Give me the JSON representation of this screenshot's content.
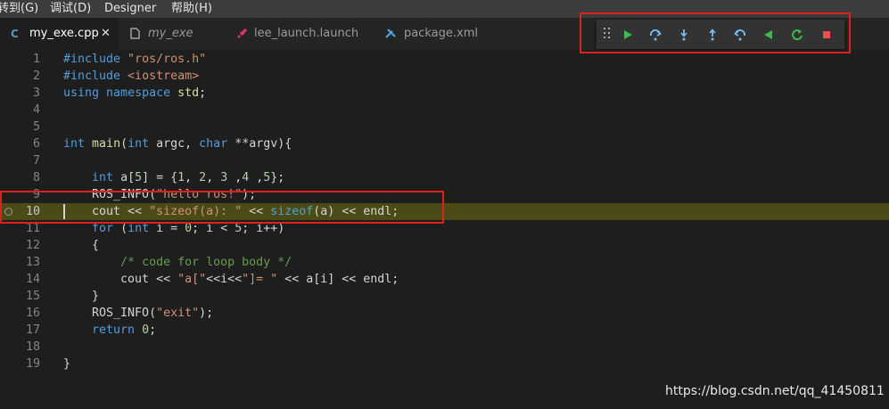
{
  "menubar": {
    "items": [
      "转到(G)",
      "调试(D)",
      "Designer",
      "帮助(H)"
    ]
  },
  "tabs": [
    {
      "label": "my_exe.cpp",
      "icon": "cpp-icon",
      "active": true
    },
    {
      "label": "my_exe",
      "icon": "file-icon",
      "active": false
    },
    {
      "label": "lee_launch.launch",
      "icon": "rocket-icon",
      "active": false
    },
    {
      "label": "package.xml",
      "icon": "tools-icon",
      "active": false
    }
  ],
  "debug_toolbar": {
    "buttons": [
      "continue",
      "step-over",
      "step-into",
      "step-out",
      "step-back",
      "reverse-continue",
      "restart",
      "stop"
    ]
  },
  "editor": {
    "current_line": 10,
    "line_numbers": [
      "1",
      "2",
      "3",
      "4",
      "5",
      "6",
      "7",
      "8",
      "9",
      "10",
      "11",
      "12",
      "13",
      "14",
      "15",
      "16",
      "17",
      "18",
      "19"
    ],
    "lines": [
      "#include \"ros/ros.h\"",
      "#include <iostream>",
      "using namespace std;",
      "",
      "",
      "int main(int argc, char **argv){",
      "",
      "    int a[5] = {1, 2, 3 ,4 ,5};",
      "    ROS_INFO(\"hello ros!\");",
      "    cout << \"sizeof(a): \" << sizeof(a) << endl;",
      "    for (int i = 0; i < 5; i++)",
      "    {",
      "        /* code for loop body */",
      "        cout << \"a[\"<<i<<\"]= \" << a[i] << endl;",
      "    }",
      "    ROS_INFO(\"exit\");",
      "    return 0;",
      "",
      "}"
    ]
  },
  "watermark": "https://blog.csdn.net/qq_41450811",
  "colors": {
    "highlight": "#4b4b18",
    "annotation_red": "#e02020",
    "play_green": "#3fb950",
    "stop_red": "#f14c4c",
    "debug_blue": "#75beff"
  }
}
